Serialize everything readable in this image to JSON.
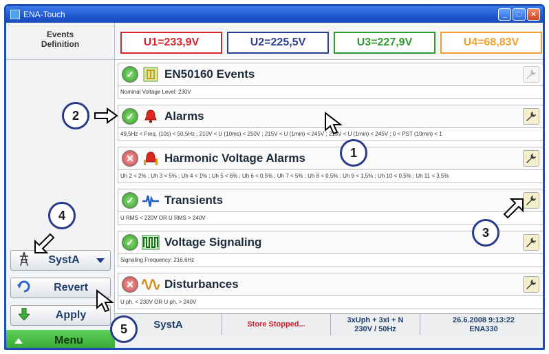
{
  "window": {
    "title": "ENA-Touch"
  },
  "left": {
    "events_definition": [
      "Events",
      "Definition"
    ],
    "system_select": "SystA",
    "revert": "Revert",
    "apply": "Apply",
    "menu": "Menu"
  },
  "voltages": [
    {
      "label": "U1=233,9V",
      "color": "#d6262a"
    },
    {
      "label": "U2=225,5V",
      "color": "#2a3f8f"
    },
    {
      "label": "U3=227,9V",
      "color": "#2f9a2f"
    },
    {
      "label": "U4=68,83V",
      "color": "#f0a030"
    }
  ],
  "events": [
    {
      "title": "EN50160 Events",
      "status": "on",
      "icon": "en50160-icon",
      "desc": "Nominal Voltage Level: 230V"
    },
    {
      "title": "Alarms",
      "status": "on",
      "icon": "bell-icon",
      "desc": "49,5Hz < Freq. (10s) < 50,5Hz ; 210V < U (10ms) < 250V ; 215V < U (1min) < 245V ; 215V < U (1min) < 245V ; 0 < PST (10min) < 1"
    },
    {
      "title": "Harmonic Voltage Alarms",
      "status": "off",
      "icon": "harmonic-bell-icon",
      "desc": "Uh 2 < 2% ; Uh 3 < 5% ; Uh 4 < 1% ; Uh 5 < 6% ; Uh 6 < 0,5% ; Uh 7 < 5% ; Uh 8 < 0,5% ; Uh 9 < 1,5% ; Uh 10 < 0,5% ; Uh 11 < 3,5%"
    },
    {
      "title": "Transients",
      "status": "on",
      "icon": "transient-icon",
      "desc": "U RMS < 220V OR U RMS > 240V"
    },
    {
      "title": "Voltage Signaling",
      "status": "on",
      "icon": "signal-icon",
      "desc": "Signaling Frequency: 216,6Hz"
    },
    {
      "title": "Disturbances",
      "status": "off",
      "icon": "disturbance-icon",
      "desc": "U ph. < 230V OR U ph. > 240V"
    }
  ],
  "statusbar": {
    "system": "SystA",
    "store": "Store Stopped...",
    "config_line1": "3xUph + 3xI + N",
    "config_line2": "230V / 50Hz",
    "datetime": "26.6.2008 9:13:22",
    "device": "ENA330",
    "store_color": "#c8202a"
  },
  "callouts": [
    "1",
    "2",
    "3",
    "4",
    "5"
  ]
}
